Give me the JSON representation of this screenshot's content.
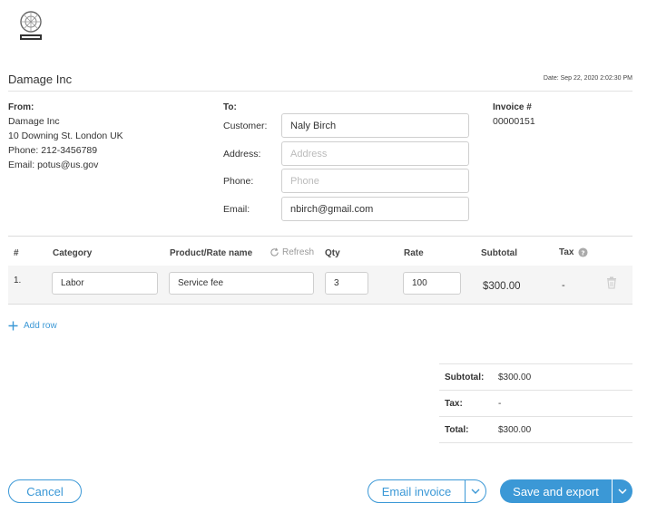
{
  "header": {
    "company_title": "Damage Inc",
    "date": "Date: Sep 22, 2020 2:02:30 PM"
  },
  "from": {
    "label": "From:",
    "lines": [
      "Damage Inc",
      "10 Downing St. London UK",
      "Phone: 212-3456789",
      "Email: potus@us.gov"
    ]
  },
  "to": {
    "label": "To:",
    "customer_label": "Customer:",
    "customer_value": "Naly Birch",
    "address_label": "Address:",
    "address_placeholder": "Address",
    "phone_label": "Phone:",
    "phone_placeholder": "Phone",
    "email_label": "Email:",
    "email_value": "nbirch@gmail.com"
  },
  "invoice": {
    "label": "Invoice #",
    "number": "00000151"
  },
  "table": {
    "headers": {
      "num": "#",
      "category": "Category",
      "product": "Product/Rate name",
      "refresh": "Refresh",
      "qty": "Qty",
      "rate": "Rate",
      "subtotal": "Subtotal",
      "tax": "Tax"
    },
    "rows": [
      {
        "num": "1.",
        "category": "Labor",
        "product": "Service fee",
        "qty": "3",
        "rate": "100",
        "subtotal": "$300.00",
        "tax": "-"
      }
    ],
    "add_row": "Add row"
  },
  "totals": {
    "subtotal_label": "Subtotal:",
    "subtotal_value": "$300.00",
    "tax_label": "Tax:",
    "tax_value": "-",
    "total_label": "Total:",
    "total_value": "$300.00"
  },
  "footer": {
    "cancel": "Cancel",
    "email_invoice": "Email invoice",
    "save_export": "Save and export"
  },
  "colors": {
    "accent": "#3b98d6"
  }
}
